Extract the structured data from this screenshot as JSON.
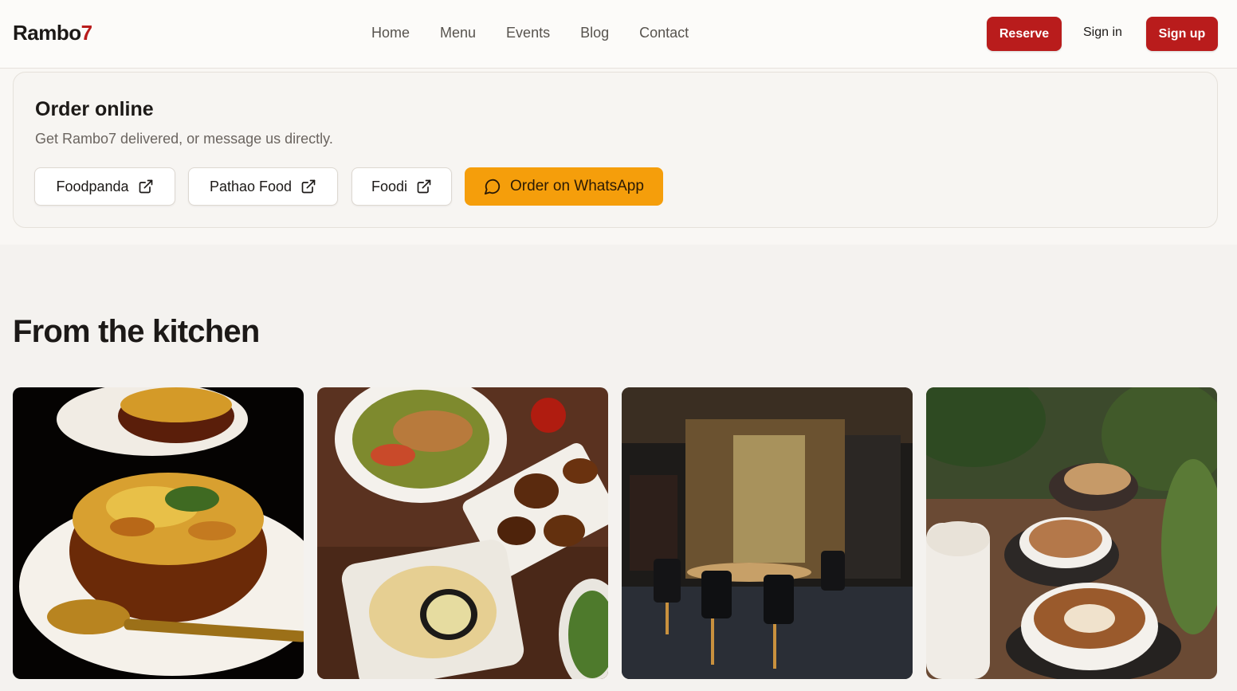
{
  "brand": {
    "name_main": "Rambo",
    "name_accent": "7",
    "accent_color": "#b91c1c"
  },
  "nav": {
    "items": [
      "Home",
      "Menu",
      "Events",
      "Blog",
      "Contact"
    ]
  },
  "header": {
    "reserve_label": "Reserve",
    "signin_label": "Sign in",
    "signup_label": "Sign up"
  },
  "order": {
    "title": "Order online",
    "subtitle": "Get Rambo7 delivered, or message us directly.",
    "platforms": [
      "Foodpanda",
      "Pathao Food",
      "Foodi"
    ],
    "external_icon": "external-link-icon",
    "whatsapp_label": "Order on WhatsApp",
    "whatsapp_icon": "chat-bubble-icon",
    "whatsapp_color": "#f59e0b"
  },
  "kitchen": {
    "title": "From the kitchen",
    "photos": [
      "biryani-photo",
      "platter-photo",
      "restaurant-interior-photo",
      "latte-photo"
    ]
  }
}
